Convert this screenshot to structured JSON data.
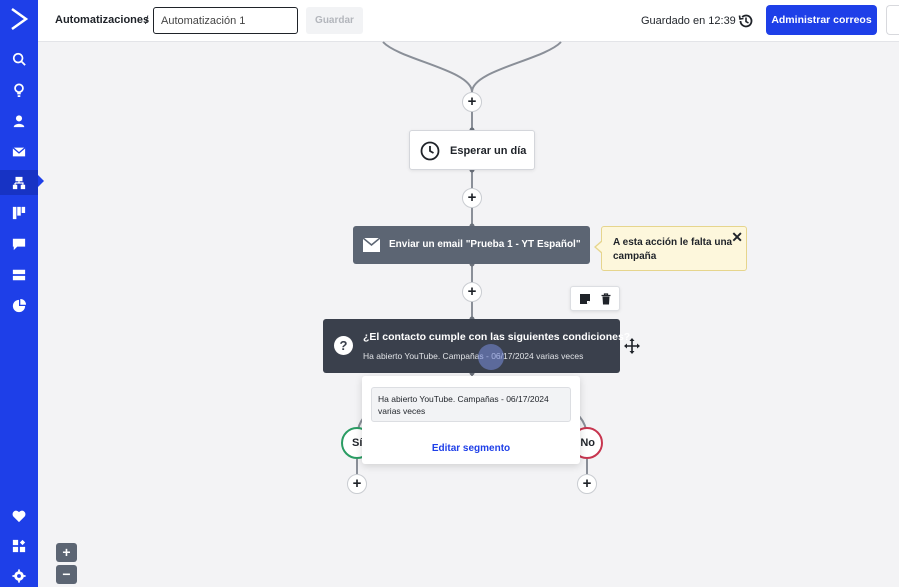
{
  "header": {
    "breadcrumb": "Automatizaciones",
    "separator": "/",
    "automation_name": "Automatización 1",
    "save_label": "Guardar",
    "saved_status": "Guardado en 12:39",
    "manage_emails_label": "Administrar correos"
  },
  "sidebar": {
    "items": [
      "search-icon",
      "lightbulb-icon",
      "contacts-icon",
      "email-icon",
      "automations-icon",
      "pipeline-icon",
      "chat-icon",
      "site-icon",
      "reports-icon",
      "favorites-icon",
      "apps-icon",
      "settings-icon"
    ],
    "active": "automations-icon",
    "accent": "#1e3fe8"
  },
  "canvas": {
    "wait_step": {
      "label": "Esperar un día",
      "icon": "clock-icon"
    },
    "email_step": {
      "label": "Enviar un email \"Prueba 1 - YT Español\"",
      "icon": "envelope-icon"
    },
    "warning": {
      "text": "A esta acción le falta una campaña",
      "close": "✕"
    },
    "condition_step": {
      "icon_text": "?",
      "title": "¿El contacto cumple con las siguientes condiciones?",
      "subtitle": "Ha abierto YouTube. Campañas - 06/17/2024 varias veces"
    },
    "popup": {
      "segment_text": "Ha abierto YouTube. Campañas - 06/17/2024 varias veces",
      "edit_label": "Editar segmento"
    },
    "branches": {
      "yes": "Sí",
      "no": "No"
    },
    "plus_label": "+"
  },
  "zoom": {
    "in": "+",
    "out": "−"
  },
  "colors": {
    "yes": "#2a9c63",
    "no": "#c7354f",
    "condition_bg": "#3a404c",
    "email_bg": "#5c6573",
    "warning_bg": "#fdf7dc"
  }
}
